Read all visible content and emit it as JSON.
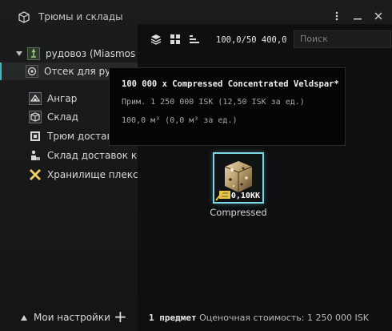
{
  "window": {
    "title": "Трюмы и склады"
  },
  "sidebar": {
    "ship": "рудовоз (Miasmos",
    "items": [
      {
        "label": "Отсек для руды",
        "icon": "ore-hold-icon"
      },
      {
        "label": "Ангар",
        "icon": "hangar-icon"
      },
      {
        "label": "Склад",
        "icon": "cargo-icon"
      },
      {
        "label": "Трюм доставк",
        "icon": "delivery-hold-icon"
      },
      {
        "label": "Склад доставок ко",
        "icon": "delivery-station-icon"
      },
      {
        "label": "Хранилище плексо",
        "icon": "plex-vault-icon"
      }
    ],
    "settings_label": "Мои настройки",
    "add_label": "+"
  },
  "toolbar": {
    "capacity": "100,0/50 400,0",
    "search_placeholder": "Поиск"
  },
  "item": {
    "name": "Compressed",
    "quantity": "0,10КК",
    "icon": "compressed-ore-icon"
  },
  "tooltip": {
    "title": "100 000 x Compressed Concentrated Veldspar*",
    "price": "Прим. 1 250 000 ISK (12,50 ISK за ед.)",
    "volume": "100,0 м³ (0,0 м³ за ед.)"
  },
  "footer": {
    "count": "1 предмет",
    "estimate": "Оценочная стоимость: 1 250 000 ISK"
  },
  "colors": {
    "accent": "#7fd6e4",
    "selection": "#3fb9c0"
  }
}
